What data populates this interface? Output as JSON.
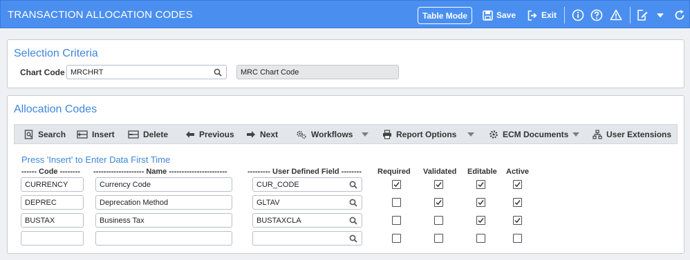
{
  "header": {
    "title": "TRANSACTION ALLOCATION CODES",
    "table_mode_label": "Table Mode",
    "save_label": "Save",
    "exit_label": "Exit"
  },
  "selection": {
    "title": "Selection Criteria",
    "chart_code_label": "Chart Code",
    "chart_code_value": "MRCHRT",
    "chart_code_desc": "MRC Chart Code"
  },
  "allocation": {
    "title": "Allocation Codes",
    "toolbar": {
      "search": "Search",
      "insert": "Insert",
      "delete": "Delete",
      "previous": "Previous",
      "next": "Next",
      "workflows": "Workflows",
      "report_options": "Report Options",
      "ecm_documents": "ECM Documents",
      "user_extensions": "User Extensions"
    },
    "hint": "Press 'Insert' to Enter Data First Time",
    "columns": {
      "code": "------ Code --------",
      "name": "-------------------- Name -----------------------",
      "udf": "--------- User Defined Field --------",
      "required": "Required",
      "validated": "Validated",
      "editable": "Editable",
      "active": "Active"
    },
    "rows": [
      {
        "code": "CURRENCY",
        "name": "Currency Code",
        "udf": "CUR_CODE",
        "required": true,
        "validated": true,
        "editable": true,
        "active": true
      },
      {
        "code": "DEPREC",
        "name": "Deprecation Method",
        "udf": "GLTAV",
        "required": false,
        "validated": true,
        "editable": true,
        "active": true
      },
      {
        "code": "BUSTAX",
        "name": "Business Tax",
        "udf": "BUSTAXCLA",
        "required": false,
        "validated": false,
        "editable": true,
        "active": true
      },
      {
        "code": "",
        "name": "",
        "udf": "",
        "required": false,
        "validated": false,
        "editable": false,
        "active": false
      }
    ]
  },
  "colors": {
    "header_bg": "#4a8ff0",
    "accent_text": "#3d86de"
  }
}
